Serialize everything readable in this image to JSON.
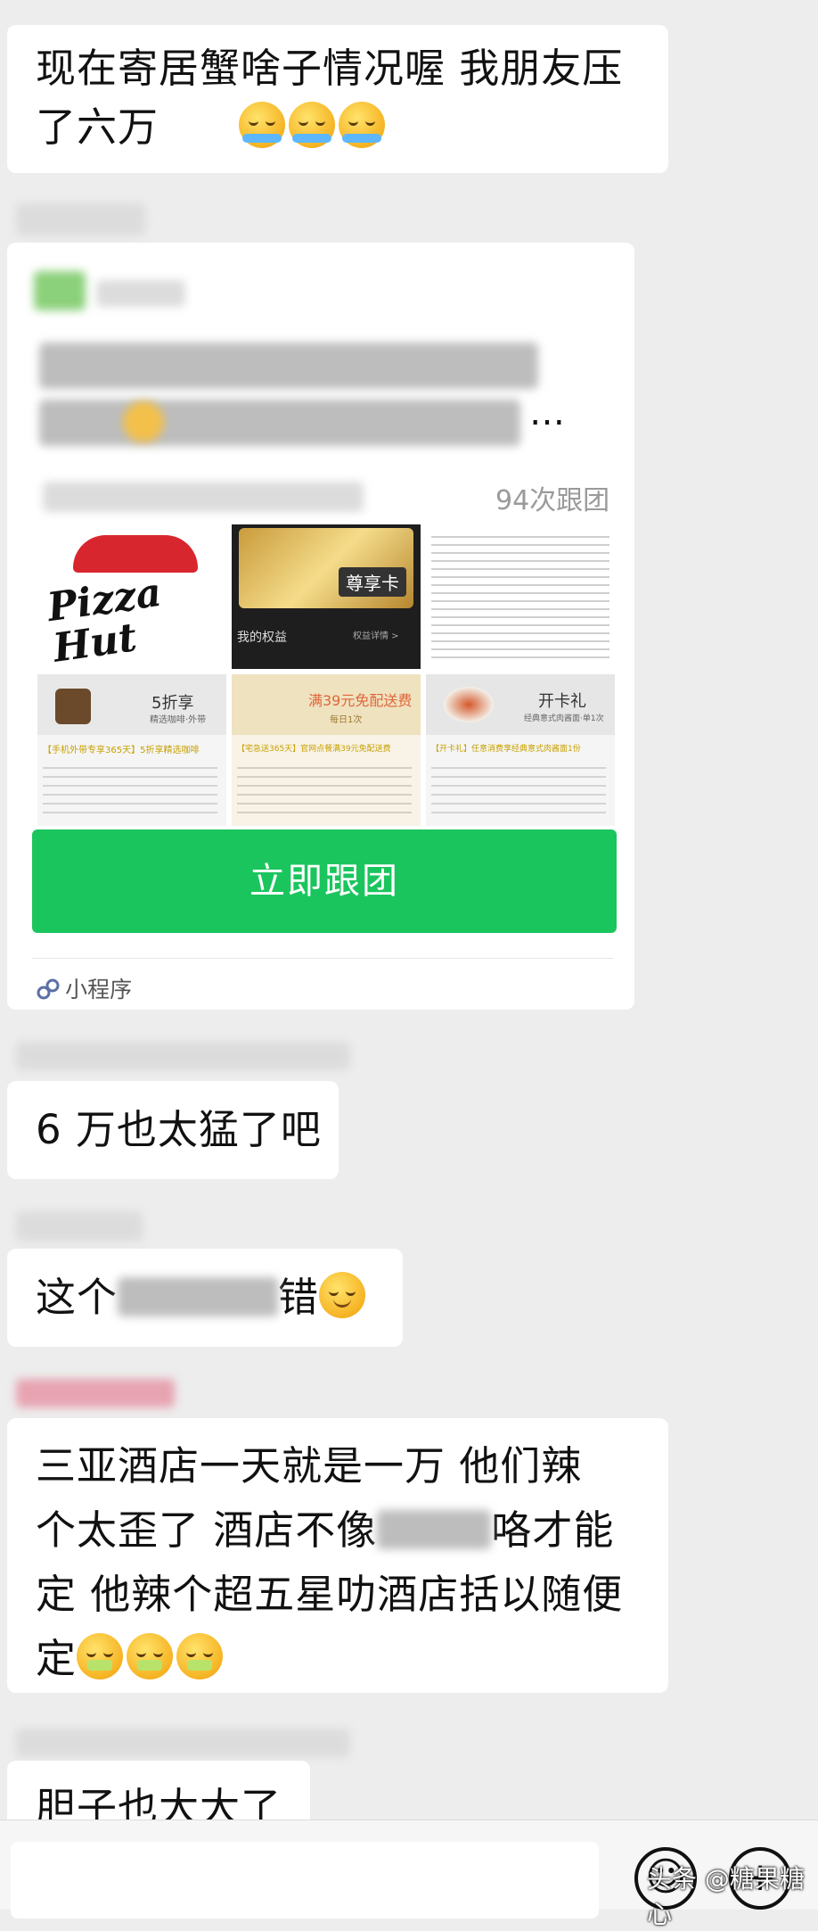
{
  "messages": [
    {
      "id": "m1",
      "text": "现在寄居蟹啥子情况喔    我朋友压了六万",
      "emojis": [
        "cry",
        "cry",
        "cry"
      ]
    },
    {
      "id": "m2",
      "text": "6 万也太猛了吧"
    },
    {
      "id": "m3",
      "text_before": "这个",
      "text_after": "错",
      "emojis": [
        "wink"
      ]
    },
    {
      "id": "m4",
      "line1": "三亚酒店一天就是一万     他们辣",
      "line2_a": "个太歪了    酒店不像",
      "line2_b": "咯才能",
      "line3": "定    他辣个超五星叻酒店括以随便",
      "line4": "定",
      "emojis": [
        "cash",
        "cash",
        "cash"
      ]
    },
    {
      "id": "m5",
      "text": "胆子也大大了"
    }
  ],
  "mini_program": {
    "join_count": "94次跟团",
    "button_label": "立即跟团",
    "footer_label": "小程序",
    "ellipsis": "…",
    "thumbs": {
      "pizza_brand": "Pizza Hut",
      "card_label": "尊享卡",
      "card_rights": "我的权益",
      "card_rights_more": "权益详情 >",
      "promo1_badge": "5折享",
      "promo1_caption": "精选咖啡·外带",
      "promo1_title": "【手机外带专享365天】5折享精选咖啡",
      "promo2_badge": "满39元免配送费",
      "promo2_sub": "每日1次",
      "promo2_title": "【宅急送365天】官网点餐满39元免配送费",
      "promo3_badge": "开卡礼",
      "promo3_sub": "经典意式肉酱面·单1次",
      "promo3_title": "【开卡礼】任意消费享经典意式肉酱面1份"
    }
  },
  "watermark": "头条 @糖果糖心",
  "input_icons": [
    "emoji-icon",
    "plus-icon"
  ]
}
